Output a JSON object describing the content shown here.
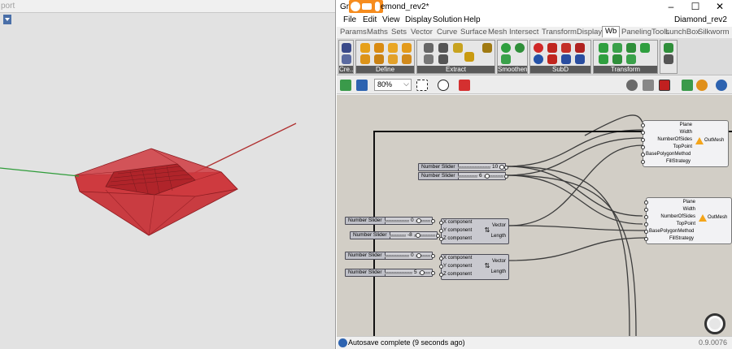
{
  "rhino": {
    "viewport_title": "port"
  },
  "grasshopper": {
    "title_prefix": "Gr",
    "title": "emond_rev2*",
    "window_controls": [
      "–",
      "☐",
      "✕"
    ],
    "menu": [
      "File",
      "Edit",
      "View",
      "Display",
      "Solution",
      "Help"
    ],
    "document_name": "Diamond_rev2",
    "tabs": [
      "Params",
      "Maths",
      "Sets",
      "Vector",
      "Curve",
      "Surface",
      "Mesh",
      "Intersect",
      "Transform",
      "Display",
      "Wb",
      "PanelingTools",
      "LunchBox",
      "Silkworm"
    ],
    "active_tab": "Wb",
    "ribbon_groups": [
      "Cre...",
      "Define",
      "Extract",
      "Smoothen",
      "SubD",
      "Transform"
    ],
    "zoom": "80%",
    "sliders": [
      {
        "label": "Number Slider",
        "value": "10"
      },
      {
        "label": "Number Slider",
        "value": "6"
      },
      {
        "label": "Number Slider",
        "value": "0"
      },
      {
        "label": "Number Slider",
        "value": "-8"
      },
      {
        "label": "Number Slider",
        "value": "0"
      },
      {
        "label": "Number Slider",
        "value": "5"
      }
    ],
    "vector_components": [
      {
        "inputs": [
          "X component",
          "Y component",
          "Z component"
        ],
        "outputs": [
          "Vector",
          "Length"
        ],
        "icon": "vector-xyz-icon"
      },
      {
        "inputs": [
          "X component",
          "Y component",
          "Z component"
        ],
        "outputs": [
          "Vector",
          "Length"
        ],
        "icon": "vector-xyz-icon"
      }
    ],
    "mesh_components": [
      {
        "inputs": [
          "Plane",
          "Width",
          "NumberOfSides",
          "TopPoint",
          "BasePolygonMethod",
          "FillStrategy"
        ],
        "output": "OutMesh"
      },
      {
        "inputs": [
          "Plane",
          "Width",
          "NumberOfSides",
          "TopPoint",
          "BasePolygonMethod",
          "FillStrategy"
        ],
        "output": "OutMesh"
      }
    ],
    "status_text": "Autosave complete (9 seconds ago)",
    "version": "0.9.0076"
  },
  "colors": {
    "mesh_red": "#c0262c",
    "canvas": "#d2cec6",
    "x_axis": "#b03030",
    "y_axis": "#2f9c3a",
    "share_bar": "#f68c1e"
  }
}
